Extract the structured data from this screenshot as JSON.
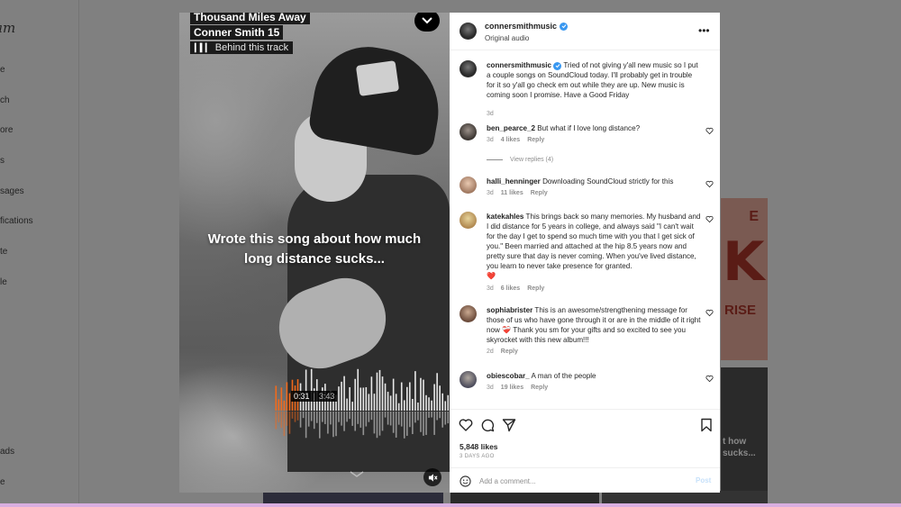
{
  "left_nav": {
    "logo": "am",
    "items": [
      "e",
      "ch",
      "ore",
      "s",
      "sages",
      "fications",
      "te",
      "le",
      "ads",
      "e"
    ]
  },
  "background": {
    "tile1_big": "K",
    "tile1_e": "E",
    "tile1_rise": "RISE",
    "tile2_text": "t how sucks..."
  },
  "video": {
    "track_title": "Thousand Miles Away",
    "artist": "Conner Smith 15",
    "behind_label": "Behind this track",
    "overlay_text": "Wrote this song about how much long distance sucks...",
    "current_time": "0:31",
    "separator": "|",
    "total_time": "3:43",
    "progress_fraction": 0.14
  },
  "post": {
    "username": "connersmithmusic",
    "audio": "Original audio",
    "caption_user": "connersmithmusic",
    "caption": "Tried of not giving y'all new music so I put a couple songs on SoundCloud today. I'll probably get in trouble for it so y'all go check em out while they are up. New music is coming soon I promise. Have a Good Friday",
    "caption_time": "3d"
  },
  "comments": [
    {
      "user": "ben_pearce_2",
      "text": "But what if I love long distance?",
      "time": "3d",
      "likes": "4 likes",
      "reply": "Reply",
      "view_replies": "View replies (4)"
    },
    {
      "user": "halli_henninger",
      "text": "Downloading SoundCloud strictly for this",
      "time": "3d",
      "likes": "11 likes",
      "reply": "Reply"
    },
    {
      "user": "katekahles",
      "text": "This brings back so many memories. My husband and I did distance for 5 years in college, and always said \"I can't wait for the day I get to spend so much time with you that I get sick of you.\" Been married and attached at the hip 8.5 years now and pretty sure that day is never coming. When you've lived distance, you learn to never take presence for granted.",
      "emoji": "❤️",
      "time": "3d",
      "likes": "6 likes",
      "reply": "Reply"
    },
    {
      "user": "sophiabrister",
      "text": "This is an awesome/strengthening message for those of us who have gone through it or are in the middle of it right now",
      "emoji": "❤️‍🩹",
      "text2": "Thank you sm for your gifts and so excited to see you skyrocket with this new album!!!",
      "time": "2d",
      "reply": "Reply"
    },
    {
      "user": "obiescobar_",
      "text": "A man of the people",
      "time": "3d",
      "likes": "19 likes",
      "reply": "Reply"
    }
  ],
  "footer": {
    "likes": "5,848 likes",
    "ago": "3 DAYS AGO",
    "add_placeholder": "Add a comment...",
    "post_label": "Post"
  },
  "colors": {
    "wave_played": "#f26a1b",
    "wave_unplayed": "#e8e8e8",
    "verified": "#3897f0",
    "heart_red": "#ed4956"
  }
}
